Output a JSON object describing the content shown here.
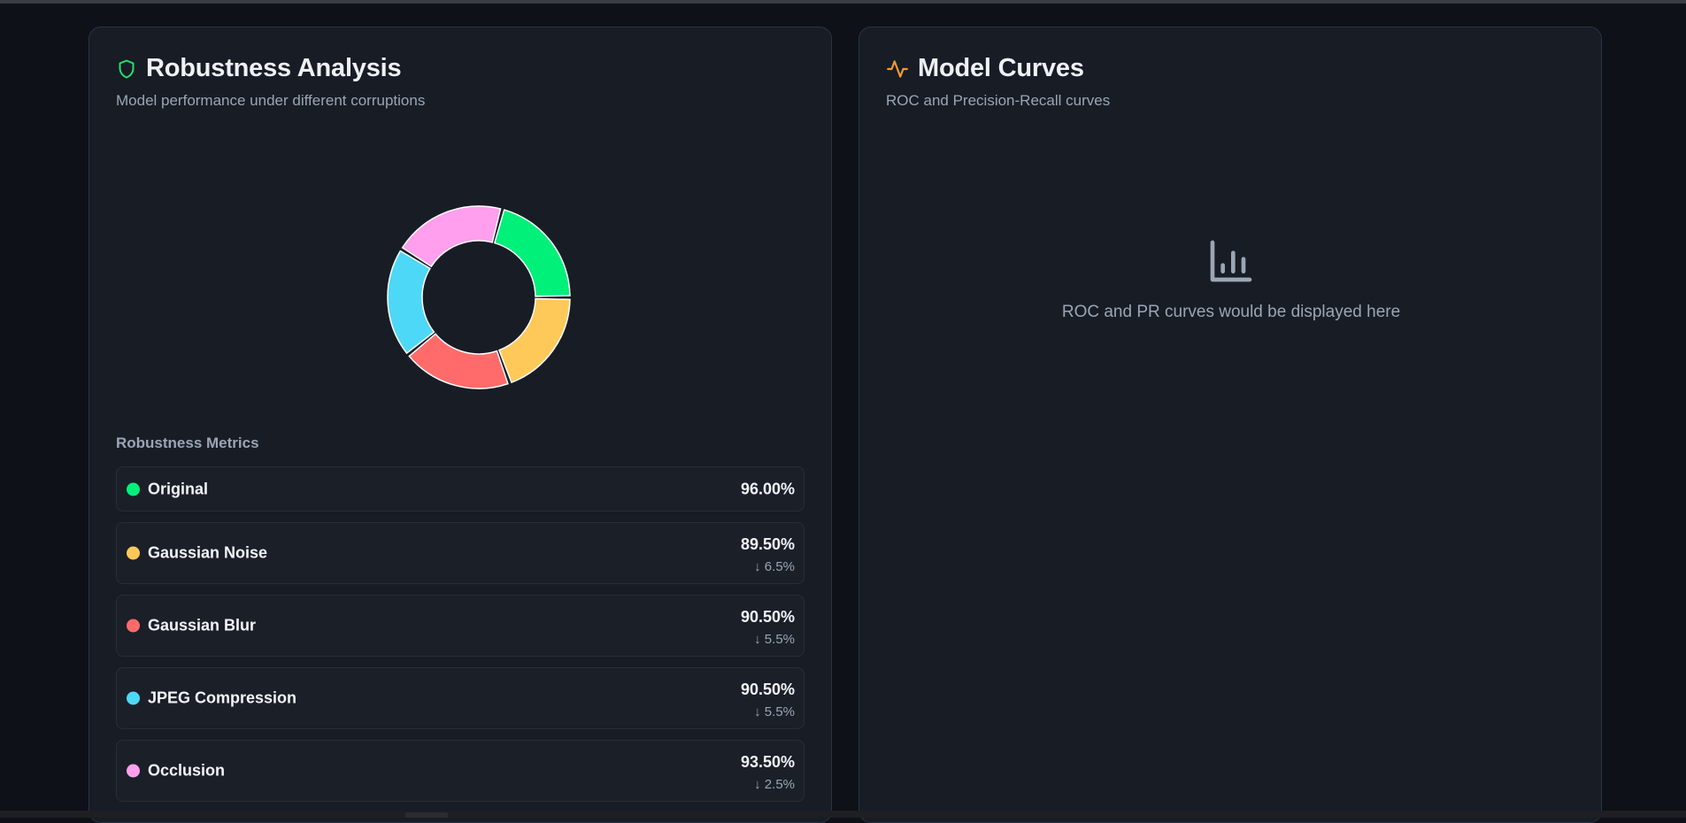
{
  "robustness": {
    "title": "Robustness Analysis",
    "subtitle": "Model performance under different corruptions",
    "header_icon": "shield-icon",
    "metrics_title": "Robustness Metrics",
    "metrics": [
      {
        "name": "Original",
        "value": "96.00%",
        "drop": "",
        "color": "#00f07a"
      },
      {
        "name": "Gaussian Noise",
        "value": "89.50%",
        "drop": "↓ 6.5%",
        "color": "#ffc95a"
      },
      {
        "name": "Gaussian Blur",
        "value": "90.50%",
        "drop": "↓ 5.5%",
        "color": "#ff6b6b"
      },
      {
        "name": "JPEG Compression",
        "value": "90.50%",
        "drop": "↓ 5.5%",
        "color": "#4ed8f7"
      },
      {
        "name": "Occlusion",
        "value": "93.50%",
        "drop": "↓ 2.5%",
        "color": "#ff9fee"
      }
    ]
  },
  "chart_data": {
    "type": "pie",
    "categories": [
      "Original",
      "Gaussian Noise",
      "Gaussian Blur",
      "JPEG Compression",
      "Occlusion"
    ],
    "values": [
      96.0,
      89.5,
      90.5,
      90.5,
      93.5
    ],
    "colors": [
      "#00f07a",
      "#ffc95a",
      "#ff6b6b",
      "#4ed8f7",
      "#ff9fee"
    ],
    "title": "",
    "legend": "none"
  },
  "curves": {
    "title": "Model Curves",
    "subtitle": "ROC and Precision-Recall curves",
    "header_icon": "activity-icon",
    "placeholder_icon": "bar-chart-icon",
    "placeholder_text": "ROC and PR curves would be displayed here"
  }
}
